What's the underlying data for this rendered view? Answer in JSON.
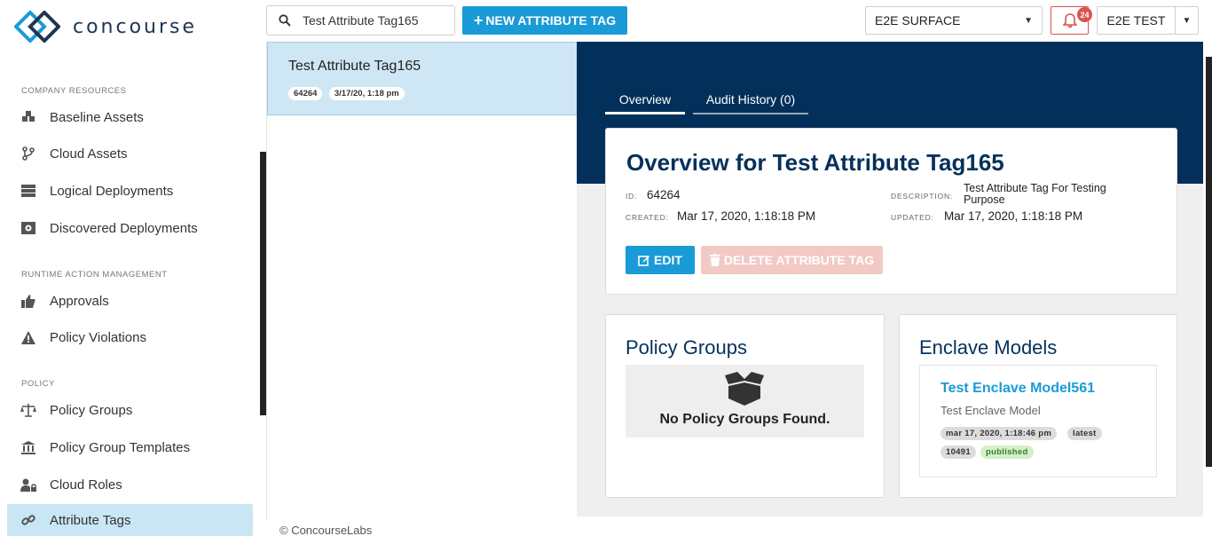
{
  "brand": {
    "name": "concourse"
  },
  "sidebar": {
    "sections": [
      {
        "title": "COMPANY RESOURCES"
      },
      {
        "title": "RUNTIME ACTION MANAGEMENT"
      },
      {
        "title": "POLICY"
      }
    ],
    "items": [
      {
        "label": "Baseline Assets",
        "icon": "cubes-icon"
      },
      {
        "label": "Cloud Assets",
        "icon": "branch-icon"
      },
      {
        "label": "Logical Deployments",
        "icon": "server-icon"
      },
      {
        "label": "Discovered Deployments",
        "icon": "discover-icon"
      },
      {
        "label": "Approvals",
        "icon": "thumbs-up-icon"
      },
      {
        "label": "Policy Violations",
        "icon": "warning-icon"
      },
      {
        "label": "Policy Groups",
        "icon": "balance-scale-icon"
      },
      {
        "label": "Policy Group Templates",
        "icon": "institution-icon"
      },
      {
        "label": "Cloud Roles",
        "icon": "user-lock-icon"
      },
      {
        "label": "Attribute Tags",
        "icon": "link-icon",
        "active": true
      }
    ]
  },
  "topbar": {
    "search_value": "Test Attribute Tag165",
    "new_button_label": "NEW ATTRIBUTE TAG",
    "surface_select": "E2E SURFACE",
    "notification_count": "24",
    "user_name": "E2E TEST"
  },
  "list": {
    "items": [
      {
        "title": "Test Attribute Tag165",
        "id": "64264",
        "date": "3/17/20, 1:18 pm"
      }
    ]
  },
  "detail": {
    "tabs": [
      {
        "label": "Overview",
        "active": true
      },
      {
        "label": "Audit History (0)"
      }
    ],
    "title": "Overview for Test Attribute Tag165",
    "id_label": "ID:",
    "id_value": "64264",
    "created_label": "CREATED:",
    "created_value": "Mar 17, 2020, 1:18:18 PM",
    "description_label": "DESCRIPTION:",
    "description_value": "Test Attribute Tag For Testing Purpose",
    "updated_label": "UPDATED:",
    "updated_value": "Mar 17, 2020, 1:18:18 PM",
    "edit_label": "EDIT",
    "delete_label": "DELETE ATTRIBUTE TAG",
    "policy_groups": {
      "title": "Policy Groups",
      "empty_text": "No Policy Groups Found."
    },
    "enclave_models": {
      "title": "Enclave Models",
      "items": [
        {
          "name": "Test Enclave Model561",
          "subtitle": "Test Enclave Model",
          "date": "mar 17, 2020, 1:18:46 pm",
          "version_tag": "latest",
          "id": "10491",
          "status": "published"
        }
      ]
    }
  },
  "footer": {
    "text": "© ConcourseLabs"
  },
  "colors": {
    "primary": "#1a9bd7",
    "navy": "#03305a",
    "danger": "#d9534f",
    "active_bg": "#c9e6f4"
  }
}
